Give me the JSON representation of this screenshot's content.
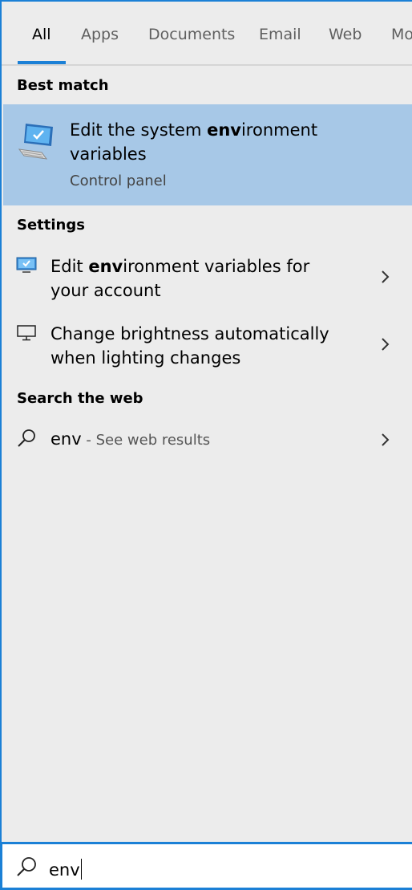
{
  "tabs": [
    {
      "label": "All"
    },
    {
      "label": "Apps"
    },
    {
      "label": "Documents"
    },
    {
      "label": "Email"
    },
    {
      "label": "Web"
    },
    {
      "label": "Mo"
    }
  ],
  "sections": {
    "best_match": "Best match",
    "settings": "Settings",
    "search_web": "Search the web"
  },
  "best_match": {
    "title_pre": "Edit the system ",
    "title_bold": "env",
    "title_post": "ironment variables",
    "subtitle": "Control panel",
    "icon": "system-properties-icon"
  },
  "settings_items": [
    {
      "pre": "Edit ",
      "bold": "env",
      "post": "ironment variables for your account",
      "icon": "monitor-icon"
    },
    {
      "pre": "Change brightness automatically when lighting changes",
      "bold": "",
      "post": "",
      "icon": "display-icon"
    }
  ],
  "web_result": {
    "query": "env",
    "suffix": " - See web results",
    "icon": "search-icon"
  },
  "search": {
    "value": "env",
    "icon": "search-icon"
  },
  "colors": {
    "accent": "#1b80d6",
    "selected_bg": "#a7c8e7",
    "panel_bg": "#ececec"
  }
}
